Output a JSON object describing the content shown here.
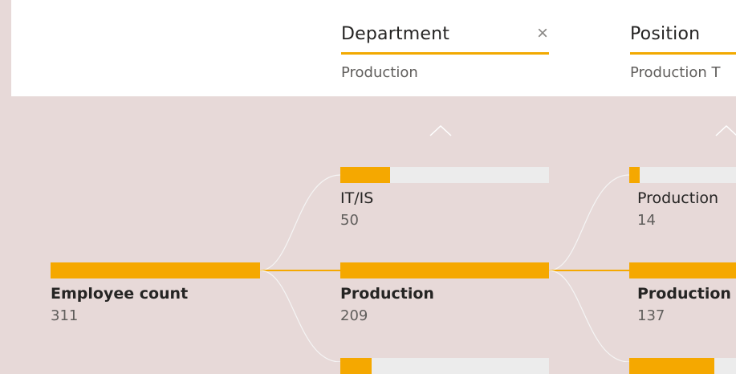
{
  "colors": {
    "accent": "#f5a800",
    "track": "#ececec",
    "background": "#e7d9d8",
    "connector": "#f5f5f5",
    "active_connector": "#f5a800"
  },
  "levels": [
    {
      "title": "Department",
      "value": "Production",
      "close_icon": "close-icon",
      "expand_icon": "chevron-up-icon"
    },
    {
      "title": "Position",
      "value": "Production T",
      "expand_icon": "chevron-up-icon"
    }
  ],
  "root": {
    "label": "Employee count",
    "value": "311",
    "fraction": 1.0
  },
  "department_nodes": [
    {
      "label": "IT/IS",
      "value": "50",
      "fraction": 0.24
    },
    {
      "label": "Production",
      "value": "209",
      "fraction": 1.0,
      "selected": true
    },
    {
      "label": "",
      "value": "",
      "fraction": 0.15
    }
  ],
  "position_nodes": [
    {
      "label": "Production",
      "value": "14",
      "fraction": 0.1
    },
    {
      "label": "Production",
      "value": "137",
      "fraction": 1.0,
      "selected": true
    },
    {
      "label": "",
      "value": "",
      "fraction": 0.8
    }
  ]
}
